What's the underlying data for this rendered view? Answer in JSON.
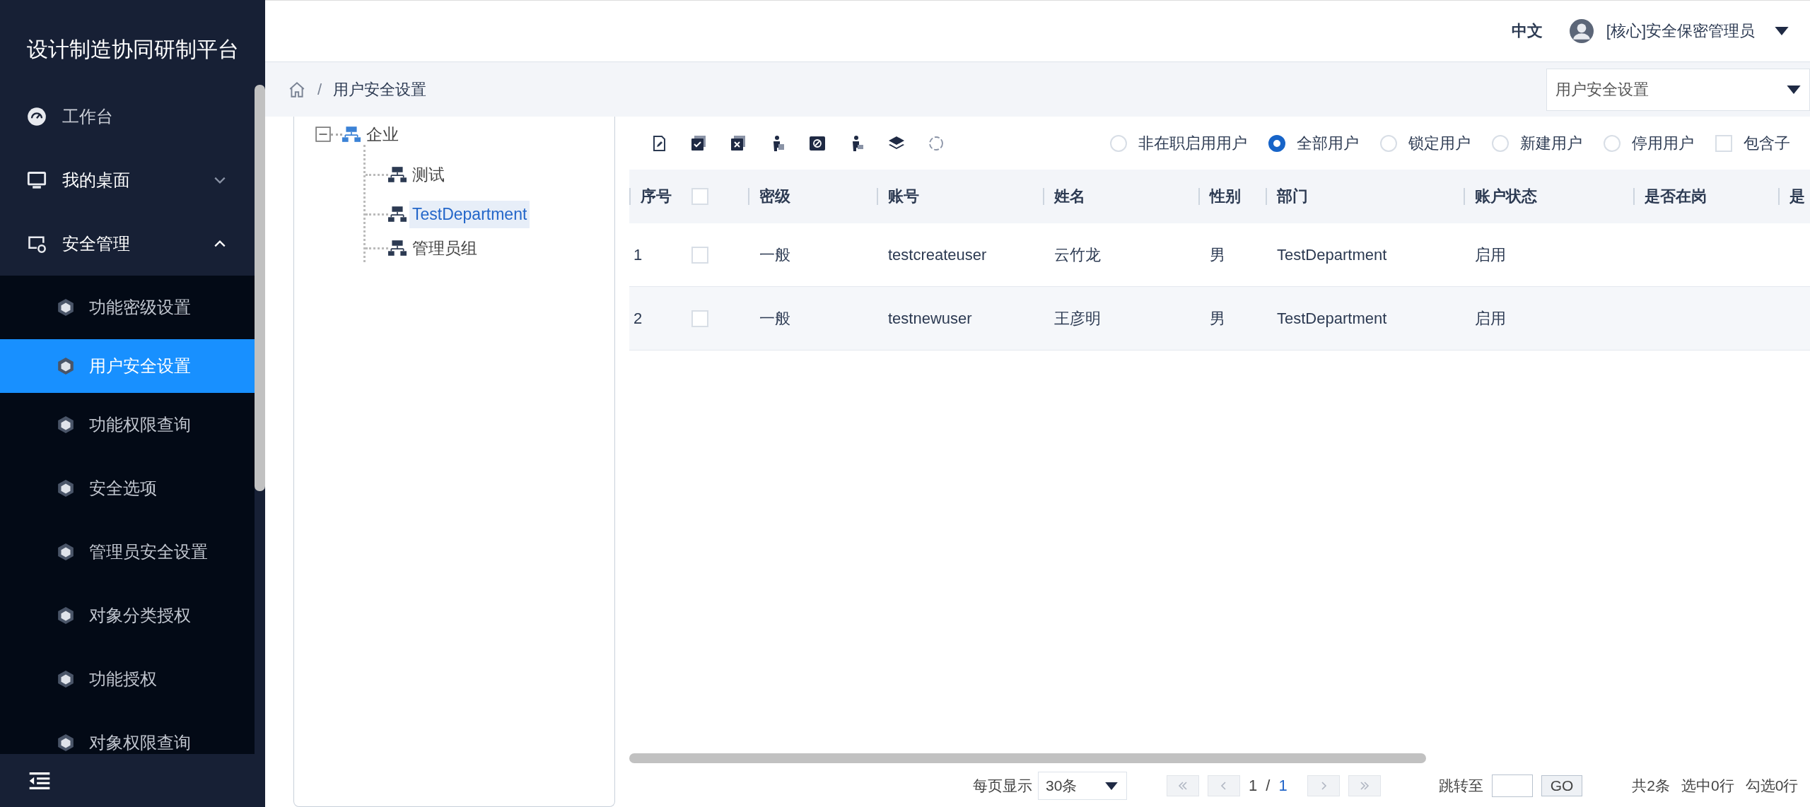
{
  "sidebar": {
    "title": "设计制造协同研制平台",
    "menu": [
      {
        "label": "工作台"
      },
      {
        "label": "我的桌面",
        "expanded": false
      },
      {
        "label": "安全管理",
        "expanded": true,
        "children": [
          {
            "label": "功能密级设置",
            "selected": false
          },
          {
            "label": "用户安全设置",
            "selected": true
          },
          {
            "label": "功能权限查询",
            "selected": false
          },
          {
            "label": "安全选项",
            "selected": false
          },
          {
            "label": "管理员安全设置",
            "selected": false
          },
          {
            "label": "对象分类授权",
            "selected": false
          },
          {
            "label": "功能授权",
            "selected": false
          },
          {
            "label": "对象权限查询",
            "selected": false
          }
        ]
      }
    ]
  },
  "header": {
    "language": "中文",
    "language_selected": true,
    "user": "[核心]安全保密管理员"
  },
  "breadcrumb": {
    "separator": "/",
    "current": "用户安全设置",
    "page_select": "用户安全设置"
  },
  "tree": {
    "label": "企业",
    "expanded": true,
    "selected": false,
    "children": [
      {
        "label": "测试",
        "selected": false
      },
      {
        "label": "TestDepartment",
        "selected": true
      },
      {
        "label": "管理员组",
        "selected": false
      }
    ]
  },
  "filters": [
    {
      "kind": "radio",
      "label": "非在职启用用户",
      "selected": false
    },
    {
      "kind": "radio",
      "label": "全部用户",
      "selected": true
    },
    {
      "kind": "radio",
      "label": "锁定用户",
      "selected": false
    },
    {
      "kind": "radio",
      "label": "新建用户",
      "selected": false
    },
    {
      "kind": "radio",
      "label": "停用用户",
      "selected": false
    },
    {
      "kind": "checkbox",
      "label": "包含子",
      "checked": false
    }
  ],
  "table": {
    "header_checked": false,
    "columns": [
      "序号",
      "密级",
      "账号",
      "姓名",
      "性别",
      "部门",
      "账户状态",
      "是否在岗",
      "是"
    ],
    "rows": [
      {
        "checked": false,
        "cells": [
          "1",
          "一般",
          "testcreateuser",
          "云竹龙",
          "男",
          "TestDepartment",
          "启用",
          "",
          ""
        ]
      },
      {
        "checked": false,
        "cells": [
          "2",
          "一般",
          "testnewuser",
          "王彦明",
          "男",
          "TestDepartment",
          "启用",
          "",
          ""
        ]
      }
    ]
  },
  "pagination": {
    "page_size_label": "每页显示",
    "page_size": "30条",
    "current": "1",
    "separator": "/",
    "total_pages": "1",
    "jump_label": "跳转至",
    "go": "GO",
    "total": "共2条",
    "selected": "选中0行",
    "checked": "勾选0行"
  }
}
